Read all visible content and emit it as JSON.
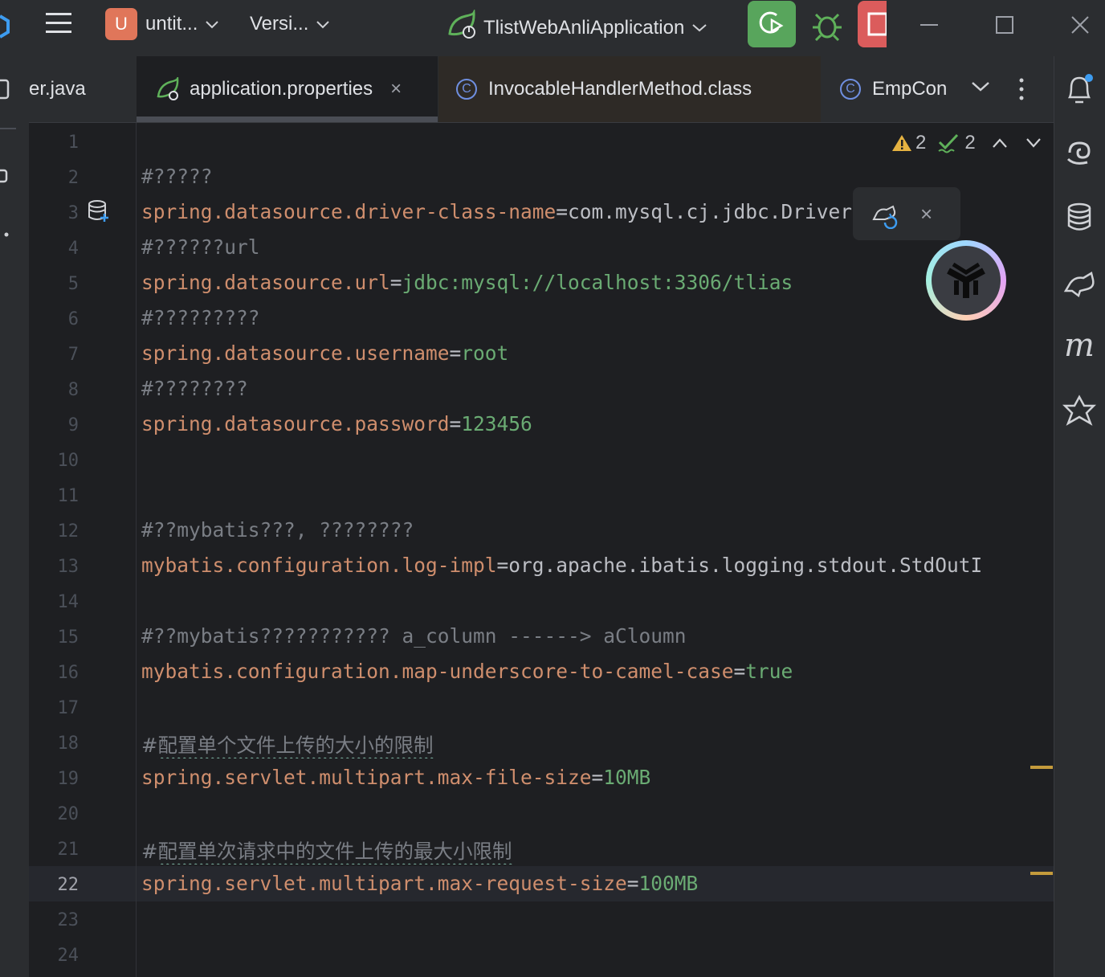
{
  "titlebar": {
    "project_badge": "U",
    "project_name": "untit...",
    "vcs_label": "Versi...",
    "run_config": "TlistWebAnliApplication",
    "icons": [
      "menu-icon",
      "run-config-icon",
      "rerun-icon",
      "debug-icon",
      "stop-icon",
      "minimize-icon",
      "maximize-icon",
      "close-icon"
    ]
  },
  "tabs": [
    {
      "label": "er.java"
    },
    {
      "label": "application.properties",
      "active": true,
      "close": "×"
    },
    {
      "label": "InvocableHandlerMethod.class",
      "icon": "C"
    },
    {
      "label": "EmpCon",
      "icon": "C"
    }
  ],
  "inspection": {
    "warnings": "2",
    "ok": "2"
  },
  "lines": [
    {
      "n": "1",
      "text": ""
    },
    {
      "n": "2",
      "text": "#?????"
    },
    {
      "n": "3",
      "key": "spring.datasource.driver-class-name",
      "value": "com.mysql.cj.jdbc.Driver"
    },
    {
      "n": "4",
      "text": "#??????url"
    },
    {
      "n": "5",
      "key": "spring.datasource.url",
      "value": "jdbc:mysql://localhost:3306/tlias"
    },
    {
      "n": "6",
      "text": "#?????????"
    },
    {
      "n": "7",
      "key": "spring.datasource.username",
      "value": "root"
    },
    {
      "n": "8",
      "text": "#????????"
    },
    {
      "n": "9",
      "key": "spring.datasource.password",
      "value": "123456"
    },
    {
      "n": "10",
      "text": ""
    },
    {
      "n": "11",
      "text": ""
    },
    {
      "n": "12",
      "text": "#??mybatis???, ????????"
    },
    {
      "n": "13",
      "key": "mybatis.configuration.log-impl",
      "value": "org.apache.ibatis.logging.stdout.StdOutI"
    },
    {
      "n": "14",
      "text": ""
    },
    {
      "n": "15",
      "text": "#??mybatis??????????? a_column ------> aCloumn"
    },
    {
      "n": "16",
      "key": "mybatis.configuration.map-underscore-to-camel-case",
      "value": "true"
    },
    {
      "n": "17",
      "text": ""
    },
    {
      "n": "18",
      "text": "#配置单个文件上传的大小的限制"
    },
    {
      "n": "19",
      "key": "spring.servlet.multipart.max-file-size",
      "value": "10MB"
    },
    {
      "n": "20",
      "text": ""
    },
    {
      "n": "21",
      "text": "#配置单次请求中的文件上传的最大小限制"
    },
    {
      "n": "22",
      "key": "spring.servlet.multipart.max-request-size",
      "value": "100MB"
    },
    {
      "n": "23",
      "text": ""
    },
    {
      "n": "24",
      "text": ""
    }
  ],
  "symbols": {
    "eq": "=",
    "close": "×",
    "chev_down": "⌄",
    "up": "⌃",
    "down": "⌄"
  }
}
